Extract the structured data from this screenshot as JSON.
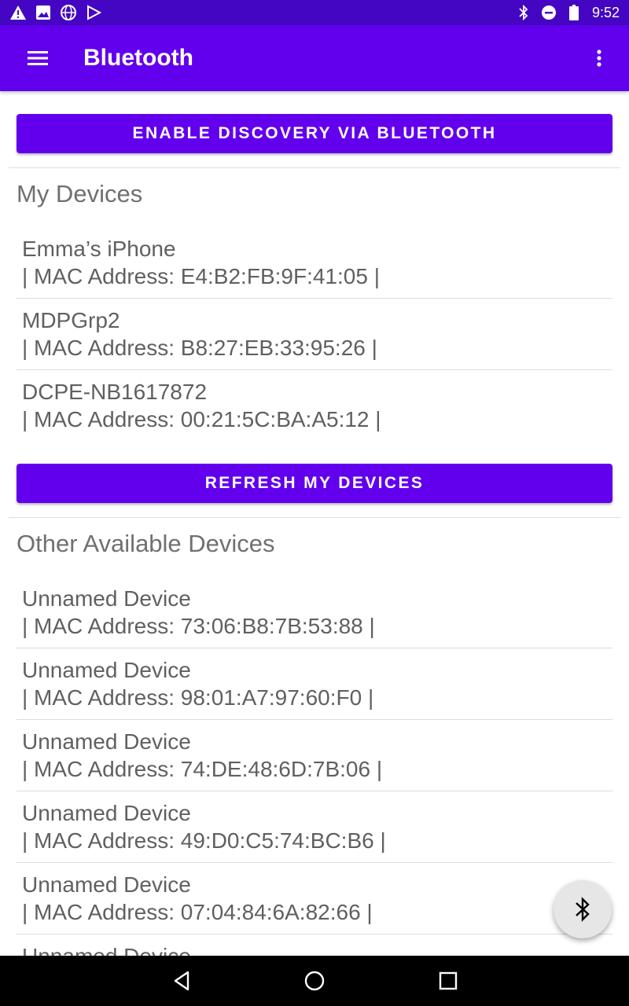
{
  "status_bar": {
    "time": "9:52",
    "left_icons": [
      "warning-icon",
      "image-icon",
      "globe-icon",
      "play-store-icon"
    ],
    "right_icons": [
      "bluetooth-icon",
      "do-not-disturb-icon",
      "battery-icon"
    ],
    "background": "#4406c2"
  },
  "app_bar": {
    "title": "Bluetooth",
    "background": "#6200ee"
  },
  "buttons": {
    "enable_discovery": "ENABLE DISCOVERY VIA BLUETOOTH",
    "refresh_my_devices": "REFRESH MY DEVICES"
  },
  "my_devices": {
    "title": "My Devices",
    "items": [
      {
        "name": "Emma’s iPhone",
        "mac": "| MAC Address: E4:B2:FB:9F:41:05 |"
      },
      {
        "name": "MDPGrp2",
        "mac": "| MAC Address: B8:27:EB:33:95:26 |"
      },
      {
        "name": "DCPE-NB1617872",
        "mac": "| MAC Address: 00:21:5C:BA:A5:12 |"
      }
    ]
  },
  "other_devices": {
    "title": "Other Available Devices",
    "items": [
      {
        "name": "Unnamed Device",
        "mac": "| MAC Address: 73:06:B8:7B:53:88 |"
      },
      {
        "name": "Unnamed Device",
        "mac": "| MAC Address: 98:01:A7:97:60:F0 |"
      },
      {
        "name": "Unnamed Device",
        "mac": "| MAC Address: 74:DE:48:6D:7B:06 |"
      },
      {
        "name": "Unnamed Device",
        "mac": "| MAC Address: 49:D0:C5:74:BC:B6 |"
      },
      {
        "name": "Unnamed Device",
        "mac": "| MAC Address: 07:04:84:6A:82:66 |"
      },
      {
        "name": "Unnamed Device",
        "mac": ""
      }
    ]
  },
  "fab": {
    "icon": "bluetooth-icon"
  },
  "nav_bar": {
    "icons": [
      "back-icon",
      "home-icon",
      "recents-icon"
    ]
  }
}
